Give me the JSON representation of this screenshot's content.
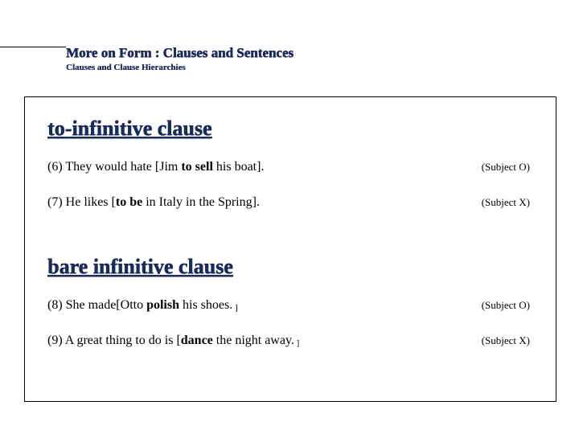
{
  "header": {
    "title": "More on Form : Clauses and Sentences",
    "subtitle": "Clauses and Clause Hierarchies"
  },
  "section1": {
    "title": "to-infinitive clause",
    "ex1": {
      "num": "(6) ",
      "a": "They would hate [Jim ",
      "b": "to sell ",
      "c": "his boat].",
      "annot": "(Subject O)"
    },
    "ex2": {
      "num": "(7) ",
      "a": "He likes [",
      "b": "to be ",
      "c": "in Italy in the Spring].",
      "annot": "(Subject X)"
    }
  },
  "section2": {
    "title": "bare infinitive clause",
    "ex1": {
      "num": "(8) ",
      "a": "She made[Otto ",
      "b": "polish ",
      "c": "his shoes.",
      "d": " ]",
      "annot": "(Subject O)"
    },
    "ex2": {
      "num": "(9) ",
      "a": "A great thing to do is [",
      "b": "dance ",
      "c": "the night away.",
      "d": " ]",
      "annot": "(Subject X)"
    }
  }
}
